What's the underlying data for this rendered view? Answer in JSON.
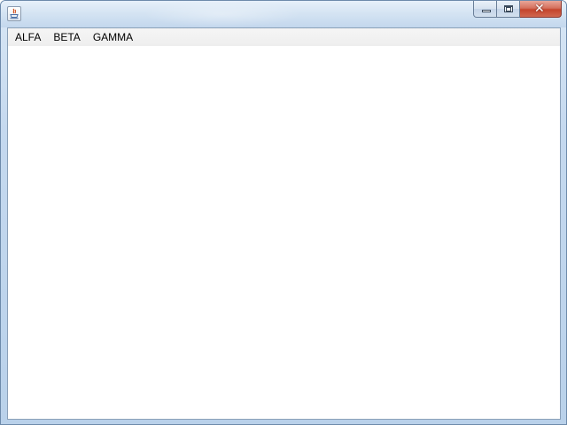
{
  "window": {
    "title": "",
    "icon": "java-cup-icon",
    "controls": {
      "minimize": "minimize-icon",
      "maximize": "maximize-icon",
      "close": "close-icon"
    }
  },
  "menubar": {
    "items": [
      {
        "label": "ALFA"
      },
      {
        "label": "BETA"
      },
      {
        "label": "GAMMA"
      }
    ]
  },
  "colors": {
    "frame": "#c3d7ed",
    "close_button": "#c4442c",
    "menubar": "#eeeeee",
    "content": "#ffffff"
  }
}
